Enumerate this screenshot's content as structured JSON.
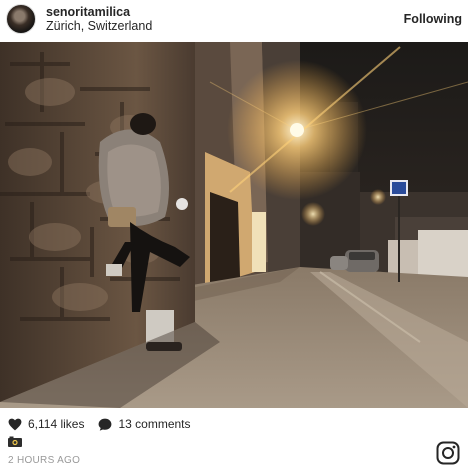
{
  "post": {
    "username": "senoritamilica",
    "location": "Zürich, Switzerland",
    "follow_label": "Following",
    "likes": "6,114 likes",
    "comments": "13 comments",
    "time_ago": "2 HOURS AGO"
  },
  "icons": {
    "avatar": "profile-photo",
    "like": "heart-icon",
    "comment": "speech-bubble-icon",
    "camera": "camera-emoji-icon",
    "brand": "instagram-logo-icon"
  },
  "colors": {
    "text": "#262626",
    "muted": "#999999",
    "street_light": "#ffd27a"
  }
}
